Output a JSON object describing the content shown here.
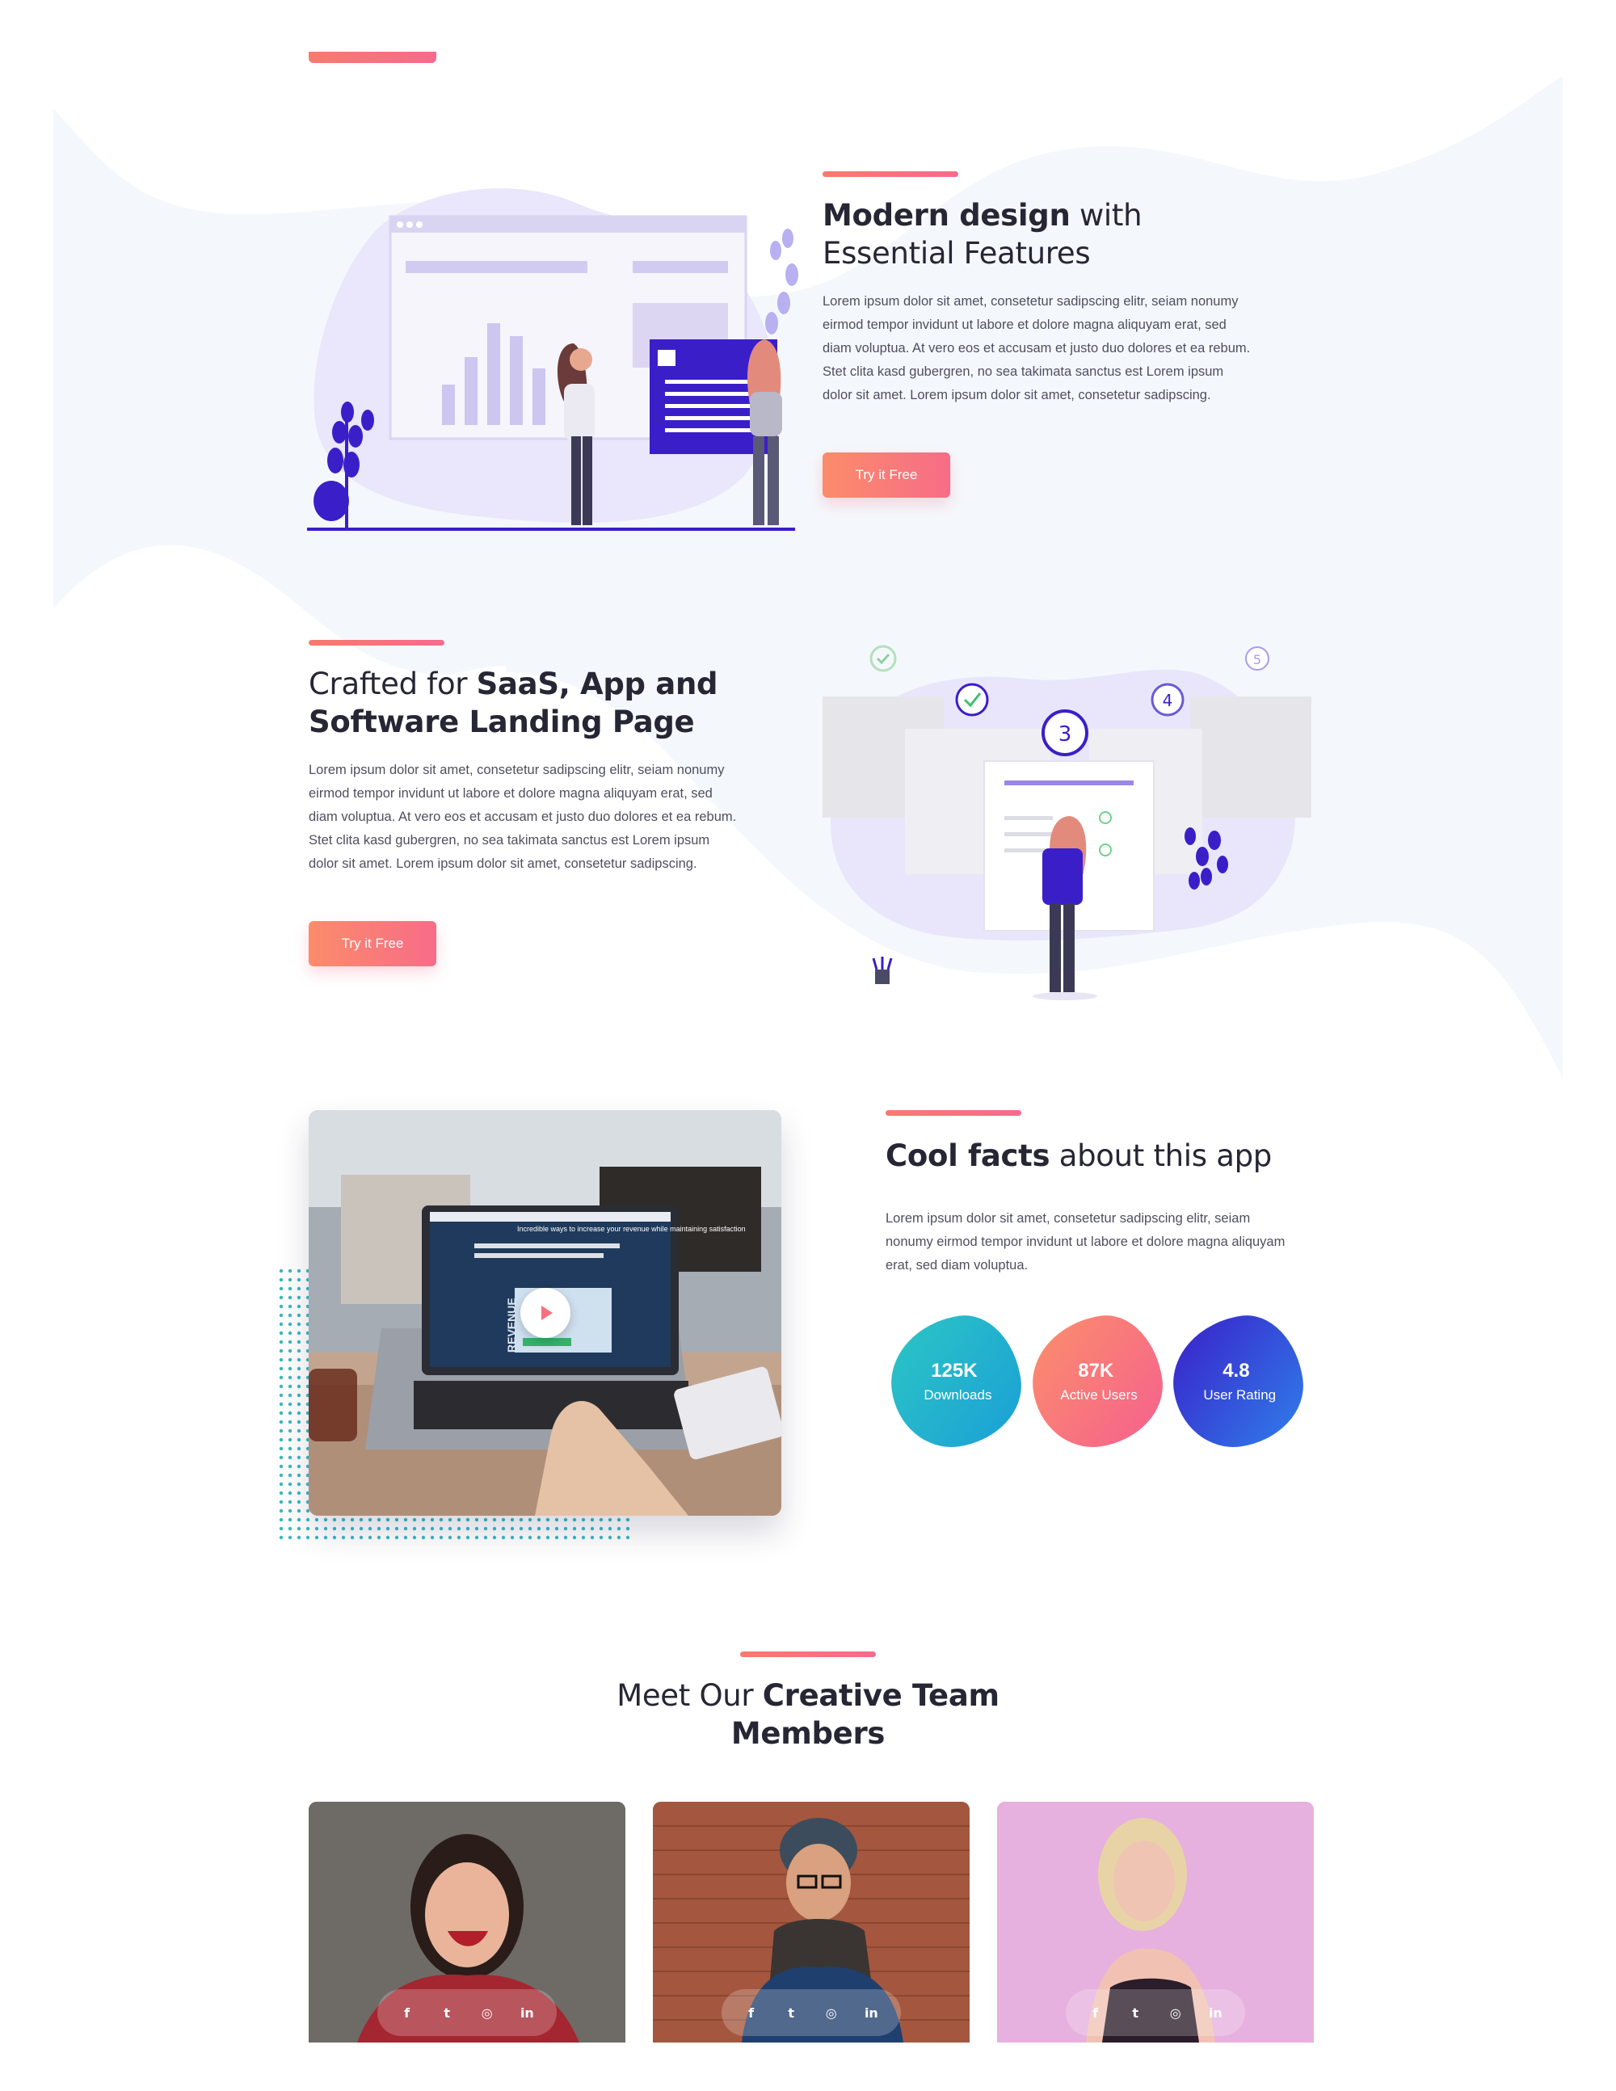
{
  "feature1": {
    "title_bold": "Modern design",
    "title_rest": " with Essential Features",
    "body": "Lorem ipsum dolor sit amet, consetetur sadipscing elitr, seiam nonumy eirmod tempor invidunt ut labore et dolore magna aliquyam erat, sed diam voluptua. At vero eos et accusam et justo duo dolores et ea rebum. Stet clita kasd gubergren, no sea takimata sanctus est Lorem ipsum dolor sit amet. Lorem ipsum dolor sit amet, consetetur sadipscing.",
    "button": "Try it Free"
  },
  "feature2": {
    "title_pre": "Crafted for ",
    "title_bold": "SaaS, App and Software Landing Page",
    "body": "Lorem ipsum dolor sit amet, consetetur sadipscing elitr, seiam nonumy eirmod tempor invidunt ut labore et dolore magna aliquyam erat, sed diam voluptua. At vero eos et accusam et justo duo dolores et ea rebum. Stet clita kasd gubergren, no sea takimata sanctus est Lorem ipsum dolor sit amet. Lorem ipsum dolor sit amet, consetetur sadipscing.",
    "button": "Try it Free",
    "steps": [
      "3",
      "4",
      "5"
    ]
  },
  "video": {
    "screen_title": "Incredible ways to increase your revenue while maintaining satisfaction",
    "screen_side": "REVENUE"
  },
  "facts": {
    "title_bold": "Cool facts",
    "title_rest": " about this app",
    "body": "Lorem ipsum dolor sit amet, consetetur sadipscing elitr, seiam nonumy eirmod tempor invidunt ut labore et dolore magna aliquyam erat, sed diam voluptua.",
    "items": [
      {
        "value": "125K",
        "label": "Downloads"
      },
      {
        "value": "87K",
        "label": "Active Users"
      },
      {
        "value": "4.8",
        "label": "User Rating"
      }
    ]
  },
  "team": {
    "title_pre": "Meet Our ",
    "title_bold": "Creative Team Members",
    "social": {
      "facebook": "f",
      "twitter": "t",
      "instagram": "◎",
      "linkedin": "in"
    }
  },
  "colors": {
    "accent": "#f7707f",
    "primary_dark": "#3a1fc9",
    "lavender": "#e9e6fb",
    "teal": "#1fb5c4"
  }
}
